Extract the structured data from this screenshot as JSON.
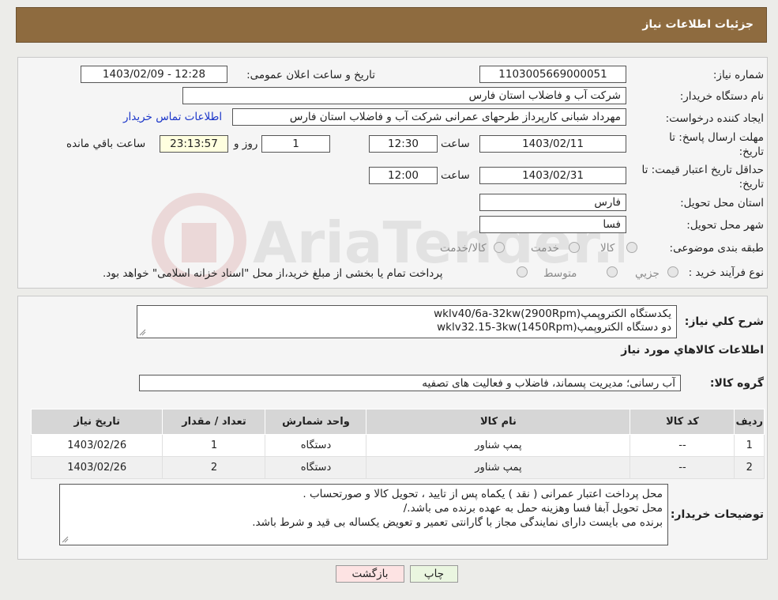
{
  "header": {
    "title": "جزئیات اطلاعات نیاز"
  },
  "watermark_text": "AriaTender.neT",
  "form": {
    "need_number_label": "شماره نیاز:",
    "need_number": "1103005669000051",
    "announce_label": "تاریخ و ساعت اعلان عمومی:",
    "announce_value": "1403/02/09 - 12:28",
    "buyer_org_label": "نام دستگاه خریدار:",
    "buyer_org": "شرکت آب و فاضلاب استان فارس",
    "creator_label": "ایجاد کننده درخواست:",
    "creator": "مهرداد شبانی کارپرداز طرحهای عمرانی  شرکت آب و فاضلاب استان فارس",
    "contact_link": "اطلاعات تماس خریدار",
    "deadline_label_1": "مهلت ارسال پاسخ: تا",
    "deadline_label_2": "تاریخ:",
    "deadline_date": "1403/02/11",
    "time_label": "ساعت",
    "deadline_time": "12:30",
    "days_value": "1",
    "days_label": "روز و",
    "remaining_time": "23:13:57",
    "remaining_label": "ساعت باقي مانده",
    "validity_label_1": "حداقل تاریخ اعتبار قیمت: تا",
    "validity_label_2": "تاریخ:",
    "validity_date": "1403/02/31",
    "validity_time": "12:00",
    "province_label": "استان محل تحویل:",
    "province": "فارس",
    "city_label": "شهر محل تحویل:",
    "city": "فسا",
    "category_label": "طبقه بندی موضوعی:",
    "category_options": [
      "کالا",
      "خدمت",
      "کالا/خدمت"
    ],
    "process_label": "نوع فرآیند خرید :",
    "process_options": [
      "جزيي",
      "متوسط"
    ],
    "process_note": "پرداخت تمام یا بخشی از مبلغ خرید،از محل \"اسناد خزانه اسلامی\" خواهد بود."
  },
  "description": {
    "label": "شرح کلي نياز:",
    "lines": [
      "یکدستگاه الکتروپمپ(wklv40/6a-32kw(2900Rpm",
      "دو دستگاه الکتروپمپ(wklv32.15-3kw(1450Rpm"
    ]
  },
  "goods_section_title": "اطلاعات کالاهاي مورد نياز",
  "goods_group": {
    "label": "گروه کالا:",
    "value": "آب رسانی؛ مدیریت پسماند، فاضلاب و فعالیت های تصفیه"
  },
  "table": {
    "headers": [
      "رديف",
      "کد کالا",
      "نام کالا",
      "واحد شمارش",
      "تعداد / مقدار",
      "تاريخ نياز"
    ],
    "rows": [
      [
        "1",
        "--",
        "پمپ شناور",
        "دستگاه",
        "1",
        "1403/02/26"
      ],
      [
        "2",
        "--",
        "پمپ شناور",
        "دستگاه",
        "2",
        "1403/02/26"
      ]
    ]
  },
  "buyer_notes": {
    "label": "توضیحات خریدار:",
    "lines": [
      "محل پرداخت اعتبار عمرانی ( نقد ) یکماه پس از تایید ، تحویل کالا و صورتحساب .",
      "محل تحویل آبفا فسا وهزینه حمل به عهده برنده می باشد./",
      "برنده می بایست دارای نمایندگی مجاز با گارانتی تعمیر و تعویض یکساله بی قید و شرط باشد."
    ]
  },
  "buttons": {
    "print": "چاپ",
    "back": "بازگشت"
  },
  "colors": {
    "header": "#8e6b3f",
    "link": "#1a35c9",
    "yellow_field": "#ffffdf",
    "back_button": "#fde3e3",
    "print_button": "#eaf6e0"
  }
}
